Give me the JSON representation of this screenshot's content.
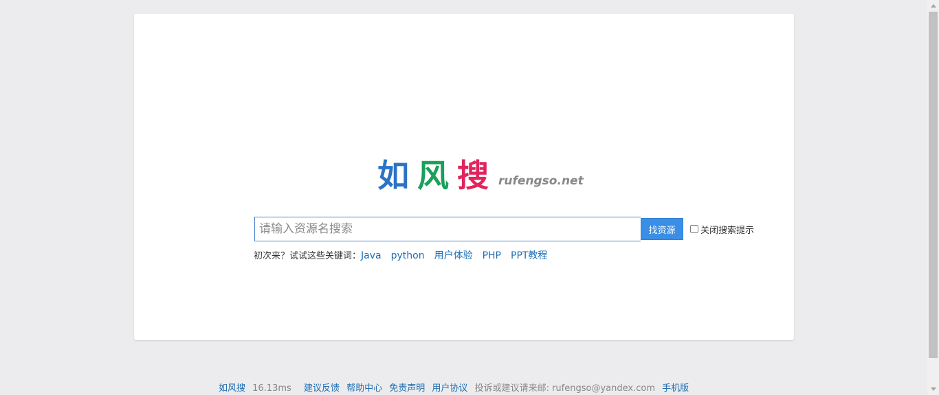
{
  "logo": {
    "chars": [
      {
        "text": "如",
        "color": "#2b73c5"
      },
      {
        "text": "风",
        "color": "#1aa05a"
      },
      {
        "text": "搜",
        "color": "#e0245e"
      }
    ],
    "domain": "rufengso.net"
  },
  "search": {
    "placeholder": "请输入资源名搜索",
    "value": "",
    "button_label": "找资源",
    "toggle_label": "关闭搜索提示",
    "toggle_checked": false
  },
  "hints": {
    "prefix": "初次来？试试这些关键词：",
    "keywords": [
      "Java",
      "python",
      "用户体验",
      "PHP",
      "PPT教程"
    ]
  },
  "footer": {
    "site_name": "如风搜",
    "response_time": "16.13ms",
    "links": [
      "建议反馈",
      "帮助中心",
      "免责声明",
      "用户协议"
    ],
    "contact": "投诉或建议请来邮: rufengso@yandex.com",
    "mobile": "手机版"
  },
  "colors": {
    "accent": "#3a8ee6",
    "link": "#1f6eb3",
    "background": "#ececee"
  }
}
